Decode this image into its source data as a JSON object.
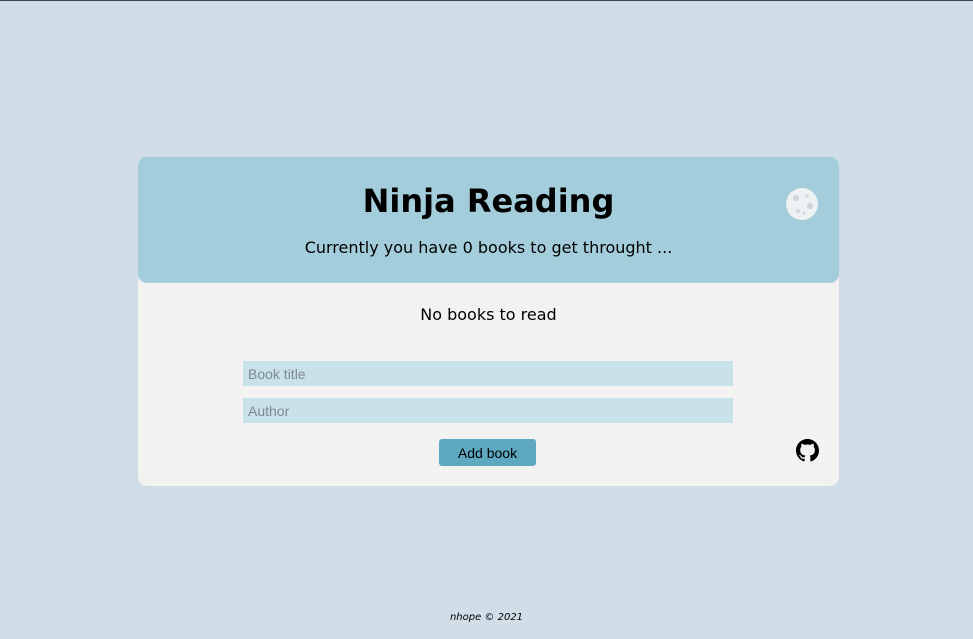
{
  "header": {
    "title": "Ninja Reading",
    "subtitle": "Currently you have 0 books to get throught ...",
    "theme_toggle_icon": "moon-icon"
  },
  "book_list": {
    "empty_message": "No books to read"
  },
  "form": {
    "title_placeholder": "Book title",
    "author_placeholder": "Author",
    "title_value": "",
    "author_value": "",
    "submit_label": "Add book"
  },
  "links": {
    "github_icon": "github-icon"
  },
  "footer": {
    "text": "nhope © 2021"
  },
  "colors": {
    "page_background": "#d1dee7",
    "header_background": "#a3cddb",
    "card_background": "#f2f2f1",
    "input_background": "#c9e1e9",
    "button_background": "#5ea8c0"
  }
}
